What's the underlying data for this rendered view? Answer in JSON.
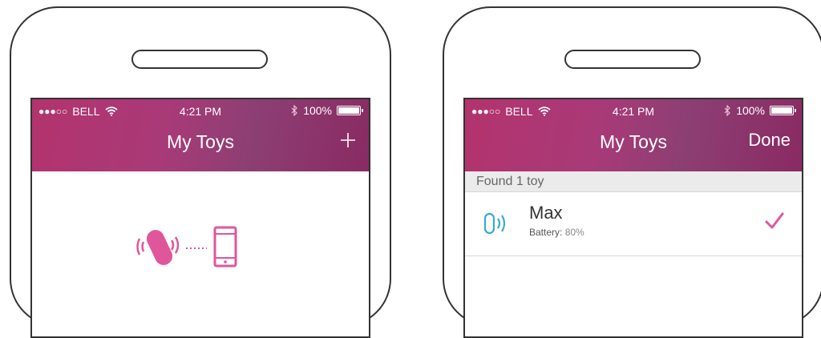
{
  "colors": {
    "accent": "#e0569a",
    "bluetooth_blue": "#3aa8d8",
    "nav_gradient_start": "#b3336d",
    "nav_gradient_end": "#8a2a63"
  },
  "status_bar": {
    "carrier": "BELL",
    "time": "4:21 PM",
    "battery": "100%"
  },
  "left_phone": {
    "nav_title": "My Toys",
    "add_icon": "plus-icon",
    "empty_state_icons": [
      "vibrator-signal-icon",
      "phone-icon"
    ]
  },
  "right_phone": {
    "nav_title": "My Toys",
    "done_label": "Done",
    "section_header": "Found 1 toy",
    "toys": [
      {
        "name": "Max",
        "battery_label": "Battery:",
        "battery_value": "80%",
        "selected": true
      }
    ]
  }
}
